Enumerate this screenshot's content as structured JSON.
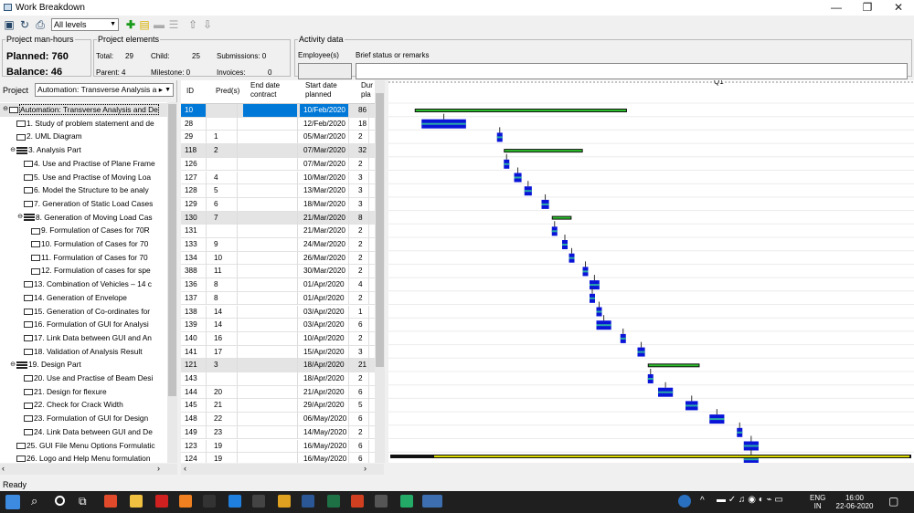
{
  "window": {
    "title": "Work Breakdown",
    "min": "—",
    "max": "❐",
    "close": "✕"
  },
  "toolbar": {
    "level_select": "All levels"
  },
  "manhours": {
    "legend": "Project man-hours",
    "planned": "Planned: 760",
    "balance": "Balance: 46"
  },
  "elements": {
    "legend": "Project elements",
    "total_l": "Total:",
    "total": "29",
    "child_l": "Child:",
    "child": "25",
    "submissions": "Submissions:  0",
    "parent": "Parent:  4",
    "milestone": "Milestone:  0",
    "invoices_l": "Invoices:",
    "invoices": "0"
  },
  "activity": {
    "legend": "Activity data",
    "employee": "Employee(s)",
    "status": "Brief status or remarks"
  },
  "project": {
    "label": "Project",
    "value": "Automation: Transverse Analysis a ▸"
  },
  "tree": [
    {
      "t": "Automation: Transverse Analysis and De",
      "k": "root",
      "lvl": 0
    },
    {
      "t": "1. Study of problem statement and de",
      "k": "task",
      "lvl": 1
    },
    {
      "t": "2. UML Diagram",
      "k": "task",
      "lvl": 1
    },
    {
      "t": "3. Analysis Part",
      "k": "sum",
      "lvl": 1
    },
    {
      "t": "4. Use and Practise of Plane Frame",
      "k": "task",
      "lvl": 2
    },
    {
      "t": "5. Use and Practise of Moving Loa",
      "k": "task",
      "lvl": 2
    },
    {
      "t": "6. Model the Structure to be analy",
      "k": "task",
      "lvl": 2
    },
    {
      "t": "7. Generation of Static Load Cases",
      "k": "task",
      "lvl": 2
    },
    {
      "t": "8. Generation of Moving Load Cas",
      "k": "sum",
      "lvl": 2
    },
    {
      "t": "9. Formulation of Cases for 70R",
      "k": "task",
      "lvl": 3
    },
    {
      "t": "10. Formulation of Cases for 70",
      "k": "task",
      "lvl": 3
    },
    {
      "t": "11. Formulation of Cases for 70",
      "k": "task",
      "lvl": 3
    },
    {
      "t": "12. Formulation of cases for spe",
      "k": "task",
      "lvl": 3
    },
    {
      "t": "13. Combination of Vehicles – 14 c",
      "k": "task",
      "lvl": 2
    },
    {
      "t": "14. Generation of Envelope",
      "k": "task",
      "lvl": 2
    },
    {
      "t": "15. Generation of Co-ordinates for",
      "k": "task",
      "lvl": 2
    },
    {
      "t": "16. Formulation of GUI for Analysi",
      "k": "task",
      "lvl": 2
    },
    {
      "t": "17. Link Data between GUI and An",
      "k": "task",
      "lvl": 2
    },
    {
      "t": "18. Validation of Analysis Result",
      "k": "task",
      "lvl": 2
    },
    {
      "t": "19. Design Part",
      "k": "sum",
      "lvl": 1
    },
    {
      "t": "20. Use and Practise of Beam Desi",
      "k": "task",
      "lvl": 2
    },
    {
      "t": "21. Design for flexure",
      "k": "task",
      "lvl": 2
    },
    {
      "t": "22. Check for Crack Width",
      "k": "task",
      "lvl": 2
    },
    {
      "t": "23. Formulation of GUI for Design",
      "k": "task",
      "lvl": 2
    },
    {
      "t": "24. Link Data between GUI and De",
      "k": "task",
      "lvl": 2
    },
    {
      "t": "25. GUI File Menu Options Formulatic",
      "k": "task",
      "lvl": 1
    },
    {
      "t": "26. Logo and Help Menu formulation",
      "k": "task",
      "lvl": 1
    }
  ],
  "table_head": {
    "id": "ID",
    "pred": "Pred(s)",
    "end": "End date contract",
    "start": "Start date planned",
    "dur": "Dur pla"
  },
  "rows": [
    {
      "id": "10",
      "pred": "",
      "start": "10/Feb/2020",
      "dur": "86",
      "s": 1,
      "sel": 1
    },
    {
      "id": "28",
      "pred": "",
      "start": "12/Feb/2020",
      "dur": "18"
    },
    {
      "id": "29",
      "pred": "1",
      "start": "05/Mar/2020",
      "dur": "2"
    },
    {
      "id": "118",
      "pred": "2",
      "start": "07/Mar/2020",
      "dur": "32",
      "s": 1
    },
    {
      "id": "126",
      "pred": "",
      "start": "07/Mar/2020",
      "dur": "2"
    },
    {
      "id": "127",
      "pred": "4",
      "start": "10/Mar/2020",
      "dur": "3"
    },
    {
      "id": "128",
      "pred": "5",
      "start": "13/Mar/2020",
      "dur": "3"
    },
    {
      "id": "129",
      "pred": "6",
      "start": "18/Mar/2020",
      "dur": "3"
    },
    {
      "id": "130",
      "pred": "7",
      "start": "21/Mar/2020",
      "dur": "8",
      "s": 1
    },
    {
      "id": "131",
      "pred": "",
      "start": "21/Mar/2020",
      "dur": "2"
    },
    {
      "id": "133",
      "pred": "9",
      "start": "24/Mar/2020",
      "dur": "2"
    },
    {
      "id": "134",
      "pred": "10",
      "start": "26/Mar/2020",
      "dur": "2"
    },
    {
      "id": "388",
      "pred": "11",
      "start": "30/Mar/2020",
      "dur": "2"
    },
    {
      "id": "136",
      "pred": "8",
      "start": "01/Apr/2020",
      "dur": "4"
    },
    {
      "id": "137",
      "pred": "8",
      "start": "01/Apr/2020",
      "dur": "2"
    },
    {
      "id": "138",
      "pred": "14",
      "start": "03/Apr/2020",
      "dur": "1"
    },
    {
      "id": "139",
      "pred": "14",
      "start": "03/Apr/2020",
      "dur": "6"
    },
    {
      "id": "140",
      "pred": "16",
      "start": "10/Apr/2020",
      "dur": "2"
    },
    {
      "id": "141",
      "pred": "17",
      "start": "15/Apr/2020",
      "dur": "3"
    },
    {
      "id": "121",
      "pred": "3",
      "start": "18/Apr/2020",
      "dur": "21",
      "s": 1
    },
    {
      "id": "143",
      "pred": "",
      "start": "18/Apr/2020",
      "dur": "2"
    },
    {
      "id": "144",
      "pred": "20",
      "start": "21/Apr/2020",
      "dur": "6"
    },
    {
      "id": "145",
      "pred": "21",
      "start": "29/Apr/2020",
      "dur": "5"
    },
    {
      "id": "148",
      "pred": "22",
      "start": "06/May/2020",
      "dur": "6"
    },
    {
      "id": "149",
      "pred": "23",
      "start": "14/May/2020",
      "dur": "2"
    },
    {
      "id": "123",
      "pred": "19",
      "start": "16/May/2020",
      "dur": "6"
    },
    {
      "id": "124",
      "pred": "19",
      "start": "16/May/2020",
      "dur": "6"
    }
  ],
  "gantt": {
    "quarter": "Q1"
  },
  "status": {
    "text": "Ready"
  },
  "taskbar": {
    "lang1": "ENG",
    "lang2": "IN",
    "time": "16:00",
    "date": "22-06-2020"
  }
}
